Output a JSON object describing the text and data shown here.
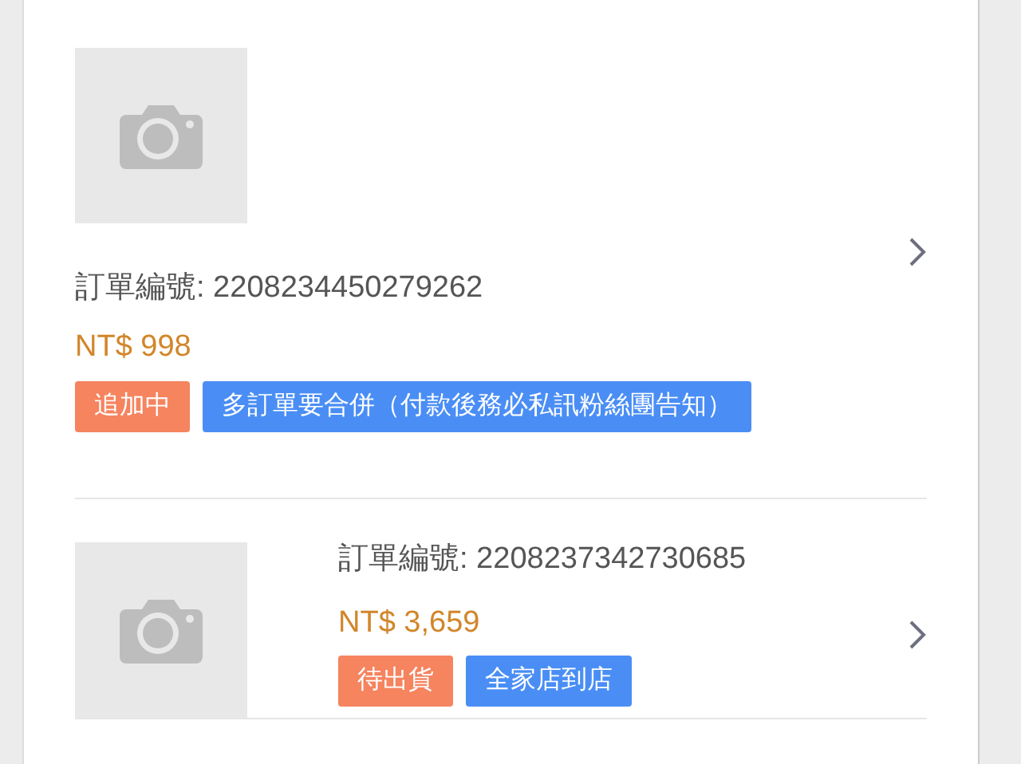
{
  "orders": [
    {
      "kind": "stacked",
      "order_number": "訂單編號: 2208234450279262",
      "price": "NT$ 998",
      "tags": [
        {
          "text": "追加中",
          "color": "#f5845f"
        },
        {
          "text": "多訂單要合併（付款後務必私訊粉絲團告知）",
          "color": "#4a8ef5"
        }
      ]
    },
    {
      "kind": "row",
      "order_number": "訂單編號: 2208237342730685",
      "price": "NT$ 3,659",
      "tags": [
        {
          "text": "待出貨",
          "color": "#f5845f"
        },
        {
          "text": "全家店到店",
          "color": "#4a8ef5"
        }
      ]
    }
  ]
}
